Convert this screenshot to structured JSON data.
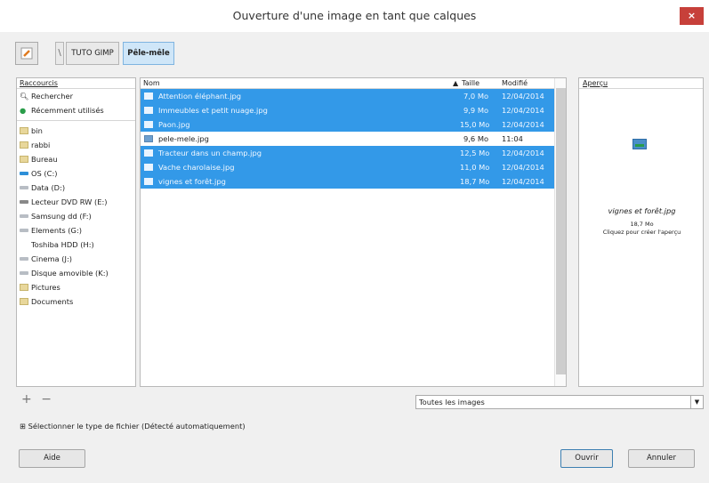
{
  "window": {
    "title": "Ouverture d'une image en tant que calques",
    "close": "×"
  },
  "path": {
    "sep": "\\",
    "crumbs": [
      "TUTO GIMP",
      "Pêle-mêle"
    ]
  },
  "places": {
    "header": "Raccourcis",
    "items": [
      {
        "label": "Rechercher",
        "icon": "search-icon"
      },
      {
        "label": "Récemment utilisés",
        "icon": "recent-icon"
      },
      {
        "label": "bin",
        "icon": "folder-icon"
      },
      {
        "label": "rabbi",
        "icon": "folder-icon"
      },
      {
        "label": "Bureau",
        "icon": "folder-icon"
      },
      {
        "label": "OS (C:)",
        "icon": "drive-icon"
      },
      {
        "label": "Data (D:)",
        "icon": "drive-icon"
      },
      {
        "label": "Lecteur DVD RW (E:)",
        "icon": "dvd-icon"
      },
      {
        "label": "Samsung dd (F:)",
        "icon": "drive-icon"
      },
      {
        "label": "Elements (G:)",
        "icon": "drive-icon"
      },
      {
        "label": "Toshiba HDD (H:)",
        "icon": "none"
      },
      {
        "label": "Cinema (J:)",
        "icon": "drive-icon"
      },
      {
        "label": "Disque amovible (K:)",
        "icon": "drive-icon"
      },
      {
        "label": "Pictures",
        "icon": "folder-icon"
      },
      {
        "label": "Documents",
        "icon": "folder-icon"
      }
    ]
  },
  "files": {
    "columns": {
      "name": "Nom",
      "sort": "▲",
      "size": "Taille",
      "modified": "Modifié"
    },
    "rows": [
      {
        "name": "Attention éléphant.jpg",
        "size": "7,0 Mo",
        "modified": "12/04/2014",
        "selected": true
      },
      {
        "name": "Immeubles et petit nuage.jpg",
        "size": "9,9 Mo",
        "modified": "12/04/2014",
        "selected": true
      },
      {
        "name": "Paon.jpg",
        "size": "15,0 Mo",
        "modified": "12/04/2014",
        "selected": true
      },
      {
        "name": "pele-mele.jpg",
        "size": "9,6 Mo",
        "modified": "11:04",
        "selected": false
      },
      {
        "name": "Tracteur dans un champ.jpg",
        "size": "12,5 Mo",
        "modified": "12/04/2014",
        "selected": true
      },
      {
        "name": "Vache charolaise.jpg",
        "size": "11,0 Mo",
        "modified": "12/04/2014",
        "selected": true
      },
      {
        "name": "vignes et forêt.jpg",
        "size": "18,7 Mo",
        "modified": "12/04/2014",
        "selected": true
      }
    ]
  },
  "preview": {
    "header": "Aperçu",
    "filename": "vignes et forêt.jpg",
    "size": "18,7 Mo",
    "hint": "Cliquez pour créer l'aperçu"
  },
  "controls": {
    "add": "+",
    "remove": "−",
    "filter_value": "Toutes les images",
    "expander": "⊞ Sélectionner le type de fichier (Détecté automatiquement)",
    "help": "Aide",
    "open": "Ouvrir",
    "cancel": "Annuler"
  },
  "colors": {
    "selection": "#3399e8",
    "close": "#c7403a"
  }
}
